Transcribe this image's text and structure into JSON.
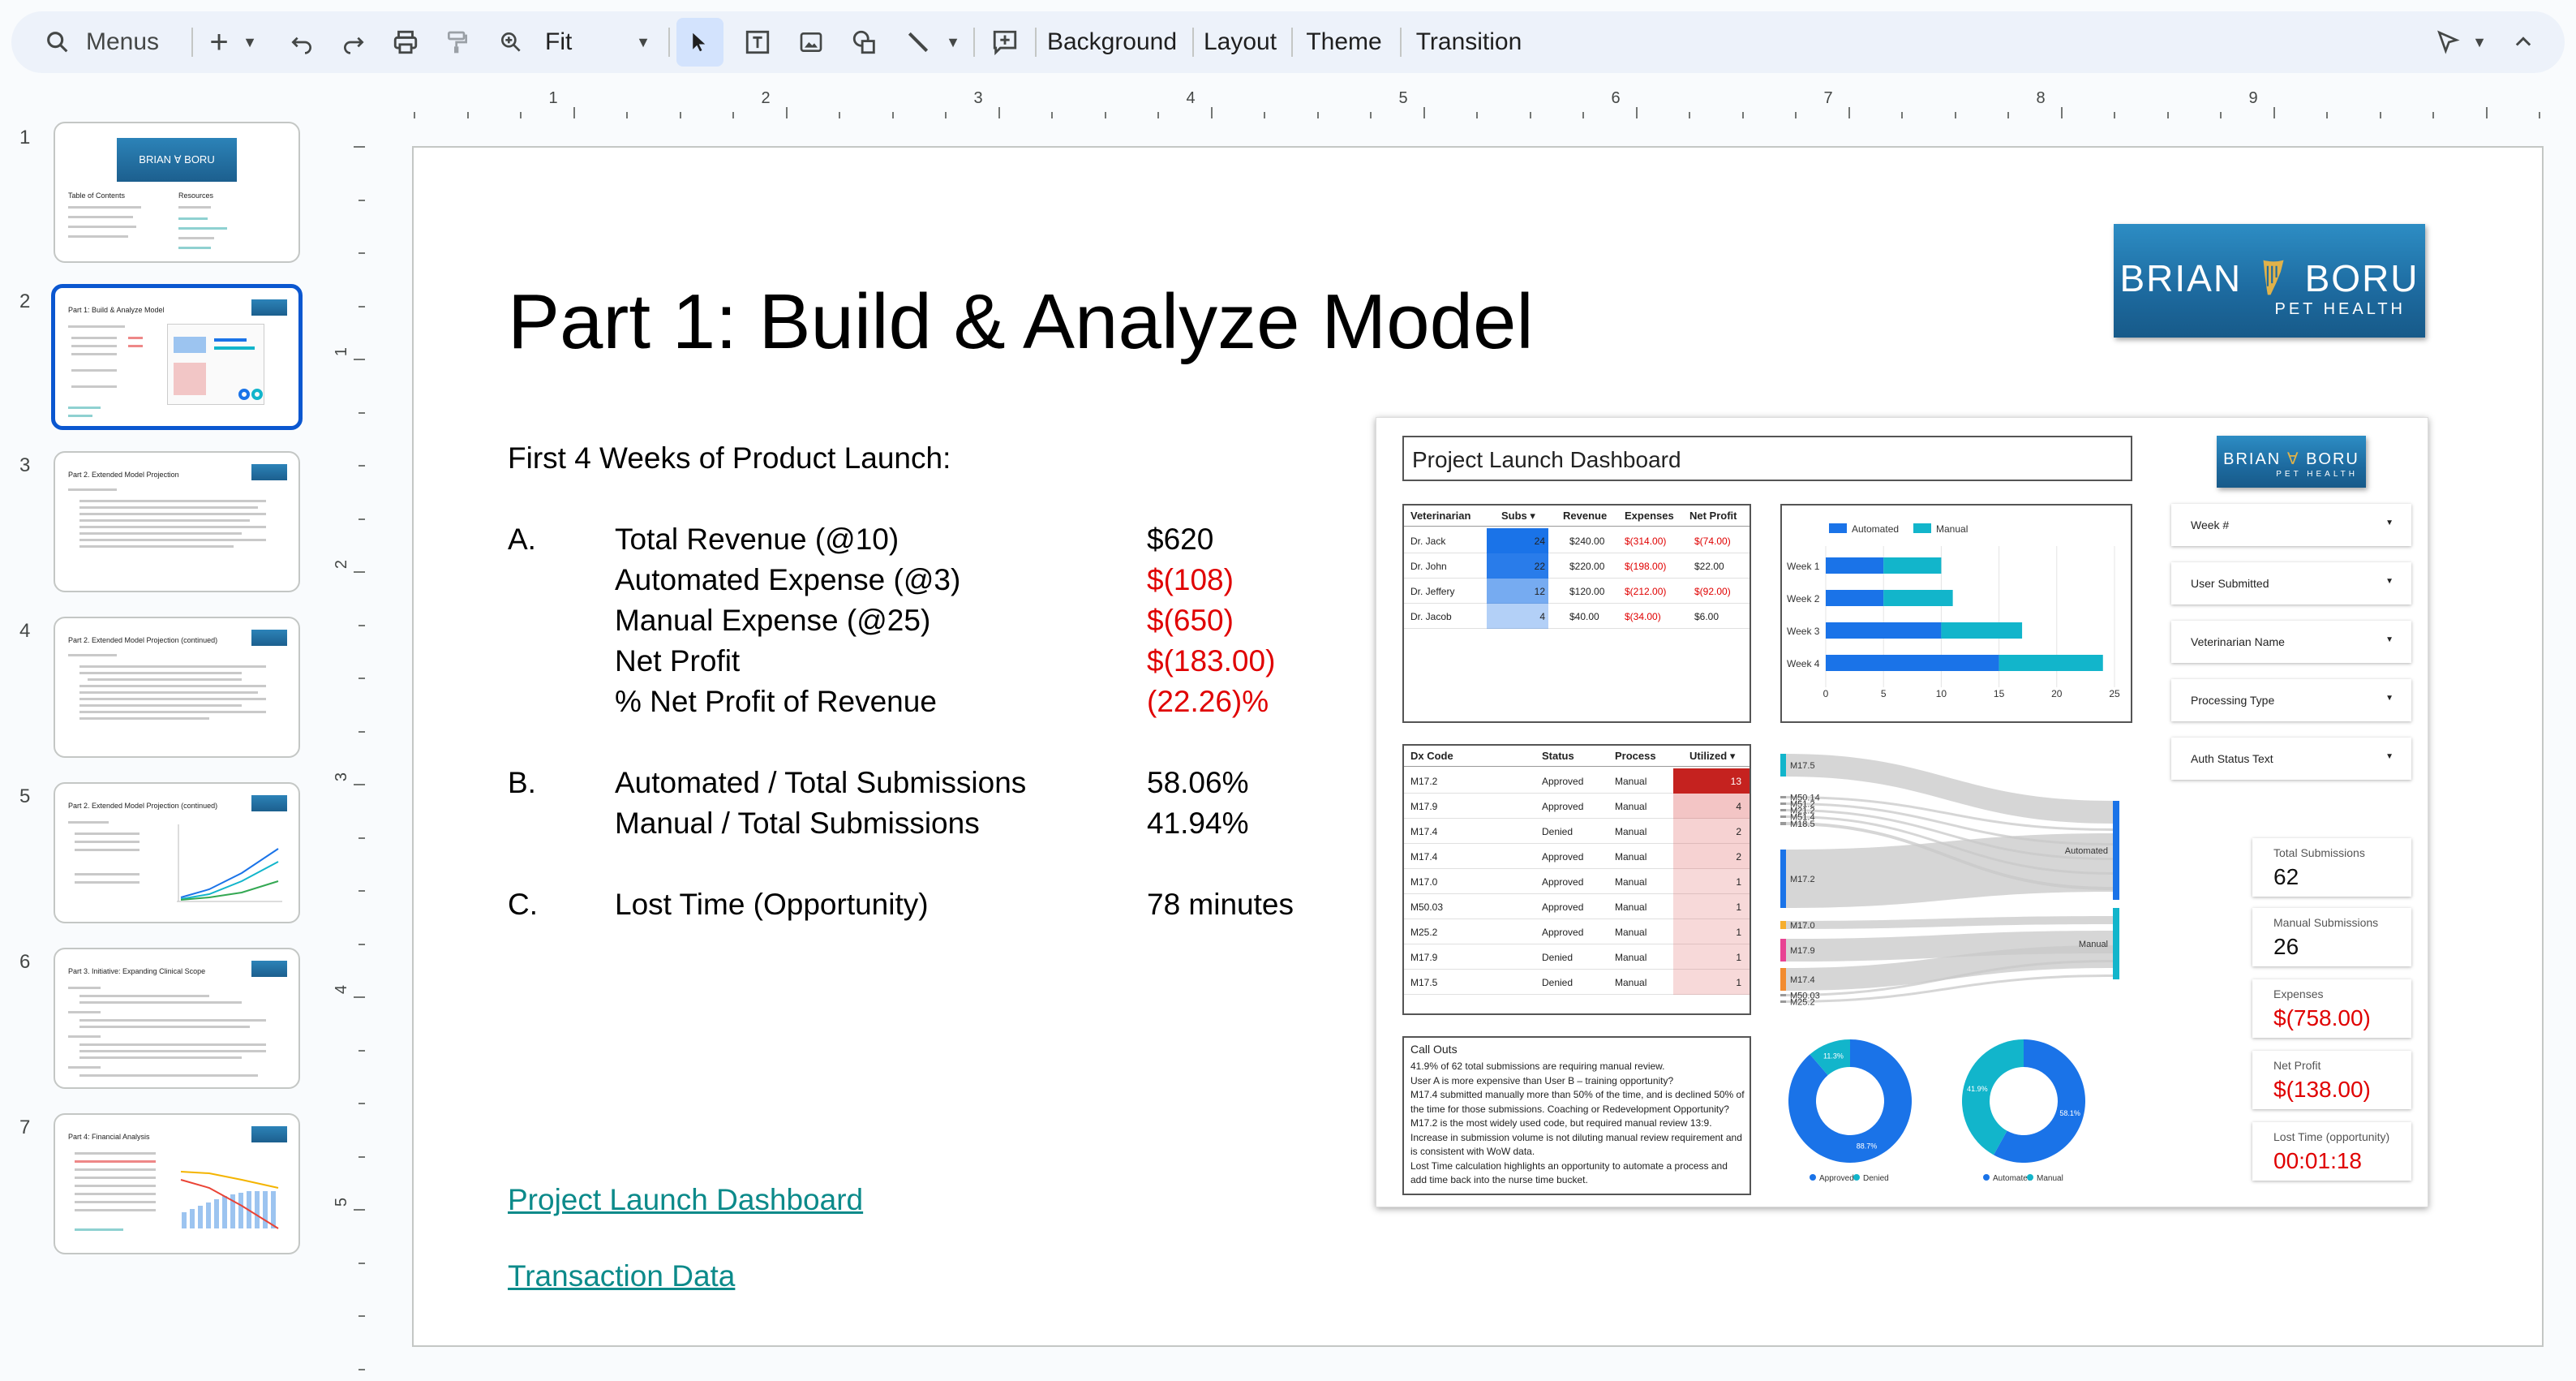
{
  "toolbar": {
    "search_label": "Menus",
    "zoom_label": "Fit",
    "background_label": "Background",
    "layout_label": "Layout",
    "theme_label": "Theme",
    "transition_label": "Transition"
  },
  "slides": [
    {
      "number": "1",
      "title": "Table of Contents"
    },
    {
      "number": "2",
      "title": "Part 1: Build & Analyze Model"
    },
    {
      "number": "3",
      "title": "Part 2. Extended Model Projection"
    },
    {
      "number": "4",
      "title": "Part 2. Extended Model Projection (continued)"
    },
    {
      "number": "5",
      "title": "Part 2. Extended Model Projection (continued)"
    },
    {
      "number": "6",
      "title": "Part 3. Initiative: Expanding Clinical Scope"
    },
    {
      "number": "7",
      "title": "Part 4: Financial Analysis"
    }
  ],
  "slide_extra": {
    "resources": "Resources"
  },
  "ruler": {
    "h": [
      "1",
      "2",
      "3",
      "4",
      "5",
      "6",
      "7",
      "8",
      "9"
    ],
    "v": [
      "1",
      "2",
      "3",
      "4",
      "5"
    ]
  },
  "slide": {
    "title": "Part 1: Build & Analyze Model",
    "subtitle": "First 4 Weeks of Product Launch:",
    "logo": {
      "main_left": "BRIAN",
      "main_right": "BORU",
      "sub": "PET HEALTH"
    },
    "sections": [
      {
        "letter": "A.",
        "rows": [
          {
            "label": "Total Revenue (@10)",
            "value": "$620",
            "negative": false
          },
          {
            "label": "Automated Expense (@3)",
            "value": "$(108)",
            "negative": true
          },
          {
            "label": "Manual Expense (@25)",
            "value": "$(650)",
            "negative": true
          },
          {
            "label": "Net Profit",
            "value": "$(183.00)",
            "negative": true
          },
          {
            "label": "% Net Profit of Revenue",
            "value": "(22.26)%",
            "negative": true
          }
        ]
      },
      {
        "letter": "B.",
        "rows": [
          {
            "label": "Automated / Total Submissions",
            "value": "58.06%",
            "negative": false
          },
          {
            "label": "Manual / Total Submissions",
            "value": "41.94%",
            "negative": false
          }
        ]
      },
      {
        "letter": "C.",
        "rows": [
          {
            "label": "Lost Time (Opportunity)",
            "value": "78 minutes",
            "negative": false
          }
        ]
      }
    ],
    "links": [
      "Project Launch Dashboard",
      "Transaction Data"
    ]
  },
  "dashboard": {
    "title": "Project Launch Dashboard",
    "vet_table": {
      "headers": [
        "Veterinarian",
        "Subs ▾",
        "Revenue",
        "Expenses",
        "Net Profit"
      ],
      "rows": [
        {
          "name": "Dr. Jack",
          "subs": "24",
          "revenue": "$240.00",
          "expenses": "$(314.00)",
          "net": "$(74.00)",
          "neg": true
        },
        {
          "name": "Dr. John",
          "subs": "22",
          "revenue": "$220.00",
          "expenses": "$(198.00)",
          "net": "$22.00",
          "neg": false
        },
        {
          "name": "Dr. Jeffery",
          "subs": "12",
          "revenue": "$120.00",
          "expenses": "$(212.00)",
          "net": "$(92.00)",
          "neg": true
        },
        {
          "name": "Dr. Jacob",
          "subs": "4",
          "revenue": "$40.00",
          "expenses": "$(34.00)",
          "net": "$6.00",
          "neg": false
        }
      ]
    },
    "dx_table": {
      "headers": [
        "Dx Code",
        "Status",
        "Process",
        "Utilized ▾"
      ],
      "rows": [
        {
          "code": "M17.2",
          "status": "Approved",
          "process": "Manual",
          "utilized": "13"
        },
        {
          "code": "M17.9",
          "status": "Approved",
          "process": "Manual",
          "utilized": "4"
        },
        {
          "code": "M17.4",
          "status": "Denied",
          "process": "Manual",
          "utilized": "2"
        },
        {
          "code": "M17.4",
          "status": "Approved",
          "process": "Manual",
          "utilized": "2"
        },
        {
          "code": "M17.0",
          "status": "Approved",
          "process": "Manual",
          "utilized": "1"
        },
        {
          "code": "M50.03",
          "status": "Approved",
          "process": "Manual",
          "utilized": "1"
        },
        {
          "code": "M25.2",
          "status": "Approved",
          "process": "Manual",
          "utilized": "1"
        },
        {
          "code": "M17.9",
          "status": "Denied",
          "process": "Manual",
          "utilized": "1"
        },
        {
          "code": "M17.5",
          "status": "Denied",
          "process": "Manual",
          "utilized": "1"
        }
      ]
    },
    "callouts": {
      "title": "Call Outs",
      "lines": [
        "41.9% of 62 total submissions are requiring manual review.",
        "User A is more expensive than User B – training opportunity?",
        "M17.4 submitted manually more than 50% of the time, and is declined 50% of",
        "the time for those submissions. Coaching or Redevelopment Opportunity?",
        "M17.2 is the most widely used code, but required manual review 13:9.",
        "Increase in submission volume is not diluting manual review requirement and",
        "is consistent with WoW data.",
        "Lost Time calculation highlights an opportunity to automate a process and",
        "add time back into the nurse time bucket."
      ]
    },
    "filters": [
      "Week #",
      "User Submitted",
      "Veterinarian Name",
      "Processing Type",
      "Auth Status Text"
    ],
    "kpis": [
      {
        "label": "Total Submissions",
        "value": "62",
        "neg": false
      },
      {
        "label": "Manual Submissions",
        "value": "26",
        "neg": false
      },
      {
        "label": "Expenses",
        "value": "$(758.00)",
        "neg": true
      },
      {
        "label": "Net Profit",
        "value": "$(138.00)",
        "neg": true
      },
      {
        "label": "Lost Time (opportunity)",
        "value": "00:01:18",
        "neg": true
      }
    ],
    "sankey": {
      "left_labels": [
        "M17.5",
        "M50.14",
        "M51.2",
        "M21.2",
        "M51.4",
        "M18.5",
        "M17.2",
        "M17.0",
        "M17.9",
        "M17.4",
        "M50.03",
        "M25.2"
      ],
      "right_labels": [
        "Automated",
        "Manual"
      ]
    },
    "donut_status": {
      "labels": [
        "Approved",
        "Denied"
      ],
      "values": [
        88.7,
        11.3
      ],
      "value_labels": [
        "88.7%",
        "11.3%"
      ]
    },
    "donut_process": {
      "labels": [
        "Automated",
        "Manual"
      ],
      "values": [
        58.1,
        41.9
      ],
      "value_labels": [
        "58.1%",
        "41.9%"
      ]
    }
  },
  "chart_data": {
    "type": "bar",
    "stacked": true,
    "orientation": "horizontal",
    "categories": [
      "Week 1",
      "Week 2",
      "Week 3",
      "Week 4"
    ],
    "series": [
      {
        "name": "Automated",
        "values": [
          5,
          5,
          10,
          15
        ],
        "color": "#1a73e8"
      },
      {
        "name": "Manual",
        "values": [
          5,
          6,
          7,
          9
        ],
        "color": "#12b5cb"
      }
    ],
    "xlim": [
      0,
      25
    ],
    "xticks": [
      "0",
      "5",
      "10",
      "15",
      "20",
      "25"
    ],
    "legend": "top"
  },
  "colors": {
    "accent": "#0b57d0",
    "negative": "#e00000",
    "link": "#0c8a8a",
    "brand": "#1d6a9f"
  }
}
